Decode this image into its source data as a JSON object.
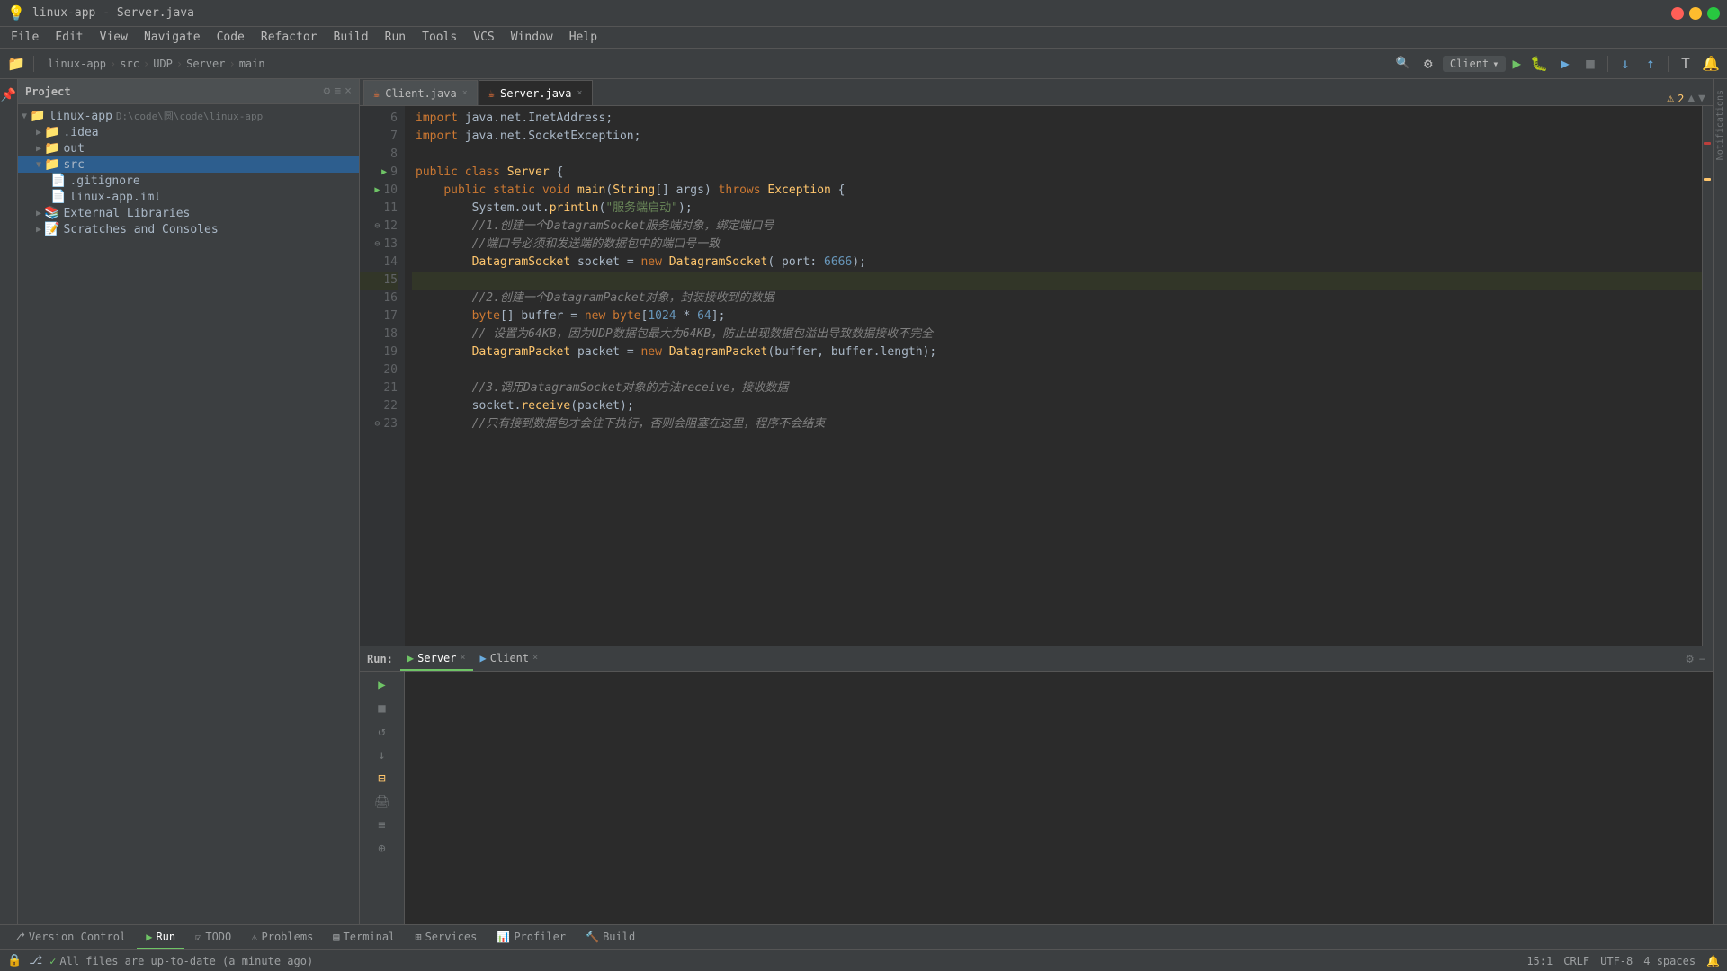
{
  "titleBar": {
    "title": "linux-app - Server.java",
    "appName": "linux-app"
  },
  "menuBar": {
    "items": [
      "File",
      "Edit",
      "View",
      "Navigate",
      "Code",
      "Refactor",
      "Build",
      "Run",
      "Tools",
      "VCS",
      "Window",
      "Help"
    ]
  },
  "breadcrumb": {
    "items": [
      "linux-app",
      "src",
      "UDP",
      "Server",
      "main"
    ]
  },
  "runConfig": {
    "label": "Client"
  },
  "tabs": [
    {
      "label": "Client.java",
      "active": false
    },
    {
      "label": "Server.java",
      "active": true
    }
  ],
  "projectTree": {
    "title": "Project",
    "items": [
      {
        "indent": 0,
        "label": "linux-app",
        "path": "D:\\code\\圆\\code\\linux-app",
        "type": "root",
        "expanded": true
      },
      {
        "indent": 1,
        "label": ".idea",
        "type": "folder",
        "expanded": false
      },
      {
        "indent": 1,
        "label": "out",
        "type": "folder",
        "expanded": false
      },
      {
        "indent": 1,
        "label": "src",
        "type": "folder",
        "expanded": true,
        "selected": true
      },
      {
        "indent": 2,
        "label": ".gitignore",
        "type": "config"
      },
      {
        "indent": 2,
        "label": "linux-app.iml",
        "type": "config"
      },
      {
        "indent": 1,
        "label": "External Libraries",
        "type": "folder"
      },
      {
        "indent": 1,
        "label": "Scratches and Consoles",
        "type": "folder"
      }
    ]
  },
  "editor": {
    "lines": [
      {
        "num": 6,
        "content": "import java.net.InetAddress;",
        "tokens": [
          {
            "text": "import ",
            "class": "kw-orange"
          },
          {
            "text": "java.net.InetAddress",
            "class": "plain"
          },
          {
            "text": ";",
            "class": "plain"
          }
        ]
      },
      {
        "num": 7,
        "content": "import java.net.SocketException;",
        "tokens": [
          {
            "text": "import ",
            "class": "kw-orange"
          },
          {
            "text": "java.net.SocketException",
            "class": "plain"
          },
          {
            "text": ";",
            "class": "plain"
          }
        ]
      },
      {
        "num": 8,
        "content": ""
      },
      {
        "num": 9,
        "content": "public class Server {",
        "runBtn": true,
        "tokens": [
          {
            "text": "public ",
            "class": "kw-orange"
          },
          {
            "text": "class ",
            "class": "kw-orange"
          },
          {
            "text": "Server ",
            "class": "type"
          },
          {
            "text": "{",
            "class": "plain"
          }
        ]
      },
      {
        "num": 10,
        "content": "    public static void main(String[] args) throws Exception {",
        "runBtn": true,
        "tokens": [
          {
            "text": "    "
          },
          {
            "text": "public ",
            "class": "kw-orange"
          },
          {
            "text": "static ",
            "class": "kw-orange"
          },
          {
            "text": "void ",
            "class": "kw-orange"
          },
          {
            "text": "main",
            "class": "method"
          },
          {
            "text": "(",
            "class": "plain"
          },
          {
            "text": "String",
            "class": "type"
          },
          {
            "text": "[] args) ",
            "class": "plain"
          },
          {
            "text": "throws ",
            "class": "kw-orange"
          },
          {
            "text": "Exception",
            "class": "type"
          },
          {
            "text": " {",
            "class": "plain"
          }
        ]
      },
      {
        "num": 11,
        "content": "        System.out.println(\"服务端启动\");",
        "tokens": [
          {
            "text": "        System.out.",
            "class": "plain"
          },
          {
            "text": "println",
            "class": "method"
          },
          {
            "text": "(\"服务端启动\");",
            "class": "str"
          }
        ]
      },
      {
        "num": 12,
        "content": "        //1.创建一个DatagramSocket服务端对象，绑定端口号",
        "tokens": [
          {
            "text": "        //1.创建一个DatagramSocket服务端对象，绑定端口号",
            "class": "comment"
          }
        ]
      },
      {
        "num": 13,
        "content": "        //端口号必须和发送端的数据包中的端口号一致",
        "tokens": [
          {
            "text": "        //端口号必须和发送端的数据包中的端口号一致",
            "class": "comment"
          }
        ]
      },
      {
        "num": 14,
        "content": "        DatagramSocket socket = new DatagramSocket( port: 6666);",
        "tokens": [
          {
            "text": "        ",
            "class": "plain"
          },
          {
            "text": "DatagramSocket",
            "class": "type"
          },
          {
            "text": " socket = ",
            "class": "plain"
          },
          {
            "text": "new ",
            "class": "kw-orange"
          },
          {
            "text": "DatagramSocket",
            "class": "type"
          },
          {
            "text": "( port: ",
            "class": "plain"
          },
          {
            "text": "6666",
            "class": "num"
          },
          {
            "text": ");",
            "class": "plain"
          }
        ]
      },
      {
        "num": 15,
        "content": "",
        "highlighted": true
      },
      {
        "num": 16,
        "content": "        //2.创建一个DatagramPacket对象，封装接收到的数据",
        "tokens": [
          {
            "text": "        //2.创建一个DatagramPacket对象，封装接收到的数据",
            "class": "comment"
          }
        ]
      },
      {
        "num": 17,
        "content": "        byte[] buffer = new byte[1024 * 64];",
        "tokens": [
          {
            "text": "        ",
            "class": "plain"
          },
          {
            "text": "byte",
            "class": "kw-orange"
          },
          {
            "text": "[] buffer = ",
            "class": "plain"
          },
          {
            "text": "new ",
            "class": "kw-orange"
          },
          {
            "text": "byte",
            "class": "kw-orange"
          },
          {
            "text": "[",
            "class": "plain"
          },
          {
            "text": "1024",
            "class": "num"
          },
          {
            "text": " * ",
            "class": "plain"
          },
          {
            "text": "64",
            "class": "num"
          },
          {
            "text": "];",
            "class": "plain"
          }
        ]
      },
      {
        "num": 18,
        "content": "        // 设置为64KB，因为UDP数据包最大为64KB，防止出现数据包溢出导致数据接收不完全",
        "tokens": [
          {
            "text": "        // 设置为64KB，因为UDP数据包最大为64KB，防止出现数据包溢出导致数据接收不完全",
            "class": "comment"
          }
        ]
      },
      {
        "num": 19,
        "content": "        DatagramPacket packet = new DatagramPacket(buffer, buffer.length);",
        "tokens": [
          {
            "text": "        ",
            "class": "plain"
          },
          {
            "text": "DatagramPacket",
            "class": "type"
          },
          {
            "text": " packet = ",
            "class": "plain"
          },
          {
            "text": "new ",
            "class": "kw-orange"
          },
          {
            "text": "DatagramPacket",
            "class": "type"
          },
          {
            "text": "(buffer, buffer.",
            "class": "plain"
          },
          {
            "text": "length",
            "class": "plain"
          },
          {
            "text": ");",
            "class": "plain"
          }
        ]
      },
      {
        "num": 20,
        "content": ""
      },
      {
        "num": 21,
        "content": "        //3.调用DatagramSocket对象的方法receive，接收数据",
        "tokens": [
          {
            "text": "        //3.调用DatagramSocket对象的方法receive，接收数据",
            "class": "comment"
          }
        ]
      },
      {
        "num": 22,
        "content": "        socket.receive(packet);",
        "tokens": [
          {
            "text": "        socket.",
            "class": "plain"
          },
          {
            "text": "receive",
            "class": "method"
          },
          {
            "text": "(packet);",
            "class": "plain"
          }
        ]
      },
      {
        "num": 23,
        "content": "        //只有接到数据包才会往下执行，否则会阻塞在这里，程序不会结束",
        "tokens": [
          {
            "text": "        //只有接到数据包才会往下执行，否则会阻塞在这里，程序不会结束",
            "class": "comment"
          }
        ]
      }
    ]
  },
  "runPanel": {
    "label": "Run:",
    "tabs": [
      {
        "label": "Server",
        "active": true
      },
      {
        "label": "Client",
        "active": false
      }
    ]
  },
  "statusBar": {
    "versionControl": "Version Control",
    "run": "Run",
    "todo": "TODO",
    "problems": "Problems",
    "terminal": "Terminal",
    "services": "Services",
    "profiler": "Profiler",
    "build": "Build",
    "position": "15:1",
    "lineEnding": "CRLF",
    "encoding": "UTF-8",
    "indent": "4 spaces",
    "statusMsg": "All files are up-to-date (a minute ago)",
    "warningCount": "2"
  },
  "notifications": {
    "label": "Notifications"
  }
}
